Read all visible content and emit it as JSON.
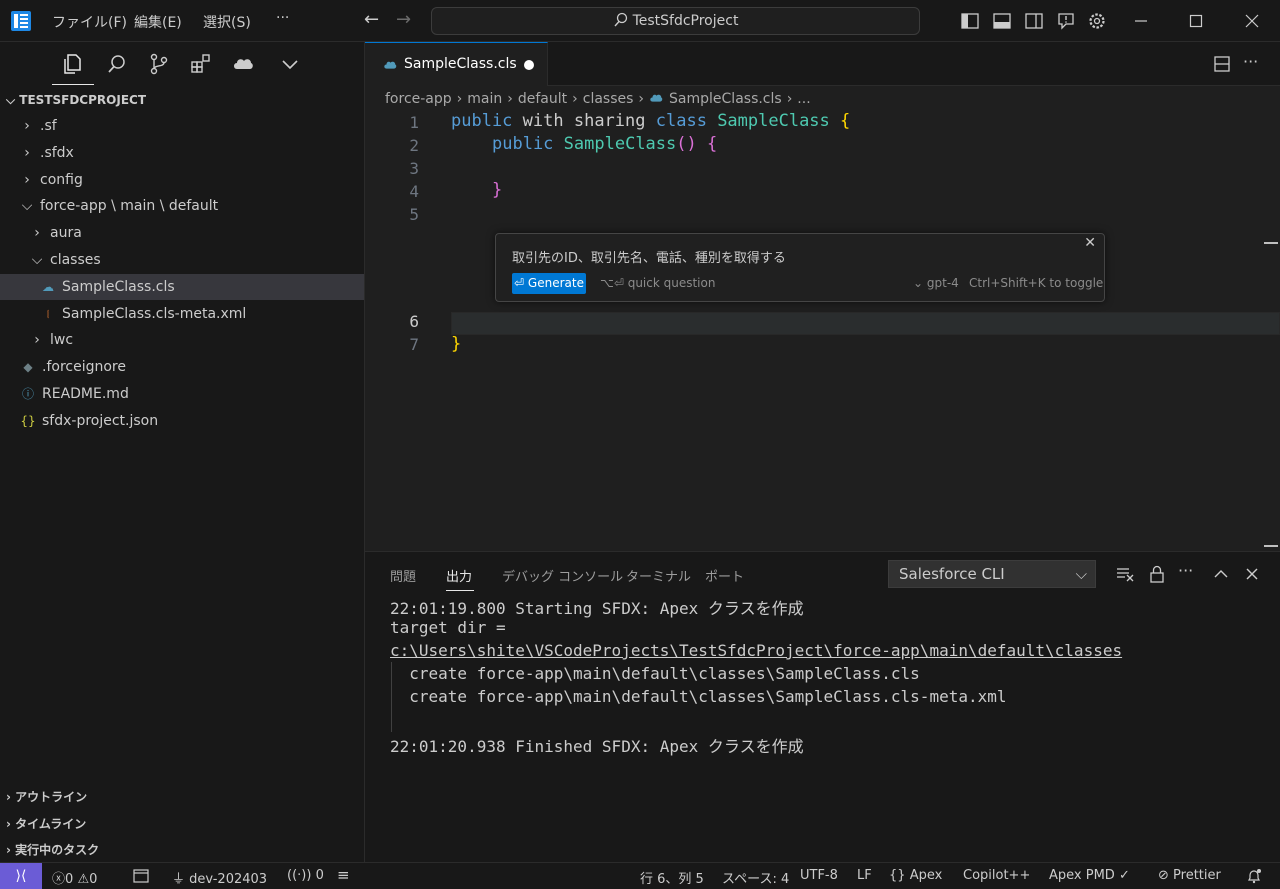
{
  "window": {
    "title": "TestSfdcProject",
    "menus": [
      "ファイル(F)",
      "編集(E)",
      "選択(S)"
    ],
    "more": "···"
  },
  "sidebar": {
    "root": "TESTSFDCPROJECT",
    "tree": [
      {
        "label": ".sf",
        "kind": "folder",
        "state": "collapsed",
        "indent": 0
      },
      {
        "label": ".sfdx",
        "kind": "folder",
        "state": "collapsed",
        "indent": 0
      },
      {
        "label": "config",
        "kind": "folder",
        "state": "collapsed",
        "indent": 0
      },
      {
        "label": "force-app \\ main \\ default",
        "kind": "folder",
        "state": "expanded",
        "indent": 0
      },
      {
        "label": "aura",
        "kind": "folder",
        "state": "collapsed",
        "indent": 1
      },
      {
        "label": "classes",
        "kind": "folder",
        "state": "expanded",
        "indent": 1
      },
      {
        "label": "SampleClass.cls",
        "kind": "apex",
        "state": "file",
        "indent": 2
      },
      {
        "label": "SampleClass.cls-meta.xml",
        "kind": "xml",
        "state": "file",
        "indent": 2
      },
      {
        "label": "lwc",
        "kind": "folder",
        "state": "collapsed",
        "indent": 1
      },
      {
        "label": ".forceignore",
        "kind": "ignore",
        "state": "file",
        "indent": 0
      },
      {
        "label": "README.md",
        "kind": "info",
        "state": "file",
        "indent": 0
      },
      {
        "label": "sfdx-project.json",
        "kind": "json",
        "state": "file",
        "indent": 0
      }
    ],
    "selected": "SampleClass.cls",
    "sections": [
      "アウトライン",
      "タイムライン",
      "実行中のタスク"
    ]
  },
  "editor": {
    "tab": {
      "label": "SampleClass.cls",
      "dirty": true
    },
    "breadcrumb": [
      "force-app",
      "main",
      "default",
      "classes",
      "SampleClass.cls",
      "..."
    ],
    "lines": {
      "l1": [
        "public",
        "with sharing",
        "class",
        "SampleClass",
        "{"
      ],
      "l2": [
        "public",
        "SampleClass",
        "()",
        "{"
      ],
      "l4": "}",
      "l7": "}"
    },
    "line_numbers": [
      "1",
      "2",
      "3",
      "4",
      "5",
      "6",
      "7"
    ],
    "inline_chat": {
      "prompt": "取引先のID、取引先名、電話、種別を取得する",
      "generate": "Generate",
      "quick_question": "⌥⏎ quick question",
      "model": "gpt-4",
      "toggle_hint": "Ctrl+Shift+K to toggle"
    }
  },
  "panel": {
    "tabs": [
      "問題",
      "出力",
      "デバッグ コンソール",
      "ターミナル",
      "ポート"
    ],
    "active_tab": "出力",
    "channel": "Salesforce CLI",
    "output": [
      "22:01:19.800 Starting SFDX: Apex クラスを作成",
      "target dir =",
      "c:\\Users\\shite\\VSCodeProjects\\TestSfdcProject\\force-app\\main\\default\\classes",
      "  create force-app\\main\\default\\classes\\SampleClass.cls",
      "  create force-app\\main\\default\\classes\\SampleClass.cls-meta.xml",
      "",
      "22:01:20.938 Finished SFDX: Apex クラスを作成"
    ]
  },
  "statusbar": {
    "errors": "0",
    "warnings": "0",
    "org": "dev-202403",
    "ports": "0",
    "position": "行 6、列 5",
    "spaces": "スペース: 4",
    "encoding": "UTF-8",
    "eol": "LF",
    "language": "Apex",
    "copilot": "Copilot++",
    "pmd": "Apex PMD",
    "prettier": "Prettier"
  },
  "colors": {
    "accent": "#0078d4",
    "remote": "#6b5cd6",
    "keyword": "#569cd6",
    "class": "#4ec9b0"
  }
}
